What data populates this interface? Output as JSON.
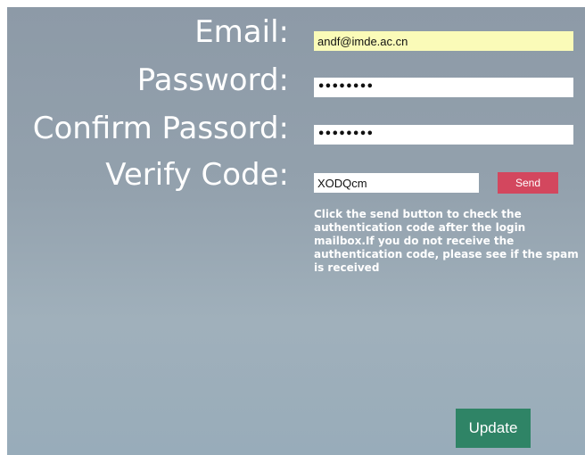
{
  "form": {
    "email_label": "Email:",
    "email_value": "andf@imde.ac.cn",
    "password_label": "Password:",
    "password_mask": "••••••••",
    "confirm_label": "Confirm Passord:",
    "confirm_mask": "••••••••",
    "verify_label": "Verify Code:",
    "verify_value": "XODQcm",
    "send_label": "Send",
    "hint": "Click the send button to check the authentication code after the login mailbox.If you do not receive the authentication code, please see if the spam is received",
    "update_label": "Update"
  },
  "colors": {
    "send_button": "#d3475e",
    "update_button": "#2f8466",
    "autofill_bg": "#fafbb8"
  }
}
